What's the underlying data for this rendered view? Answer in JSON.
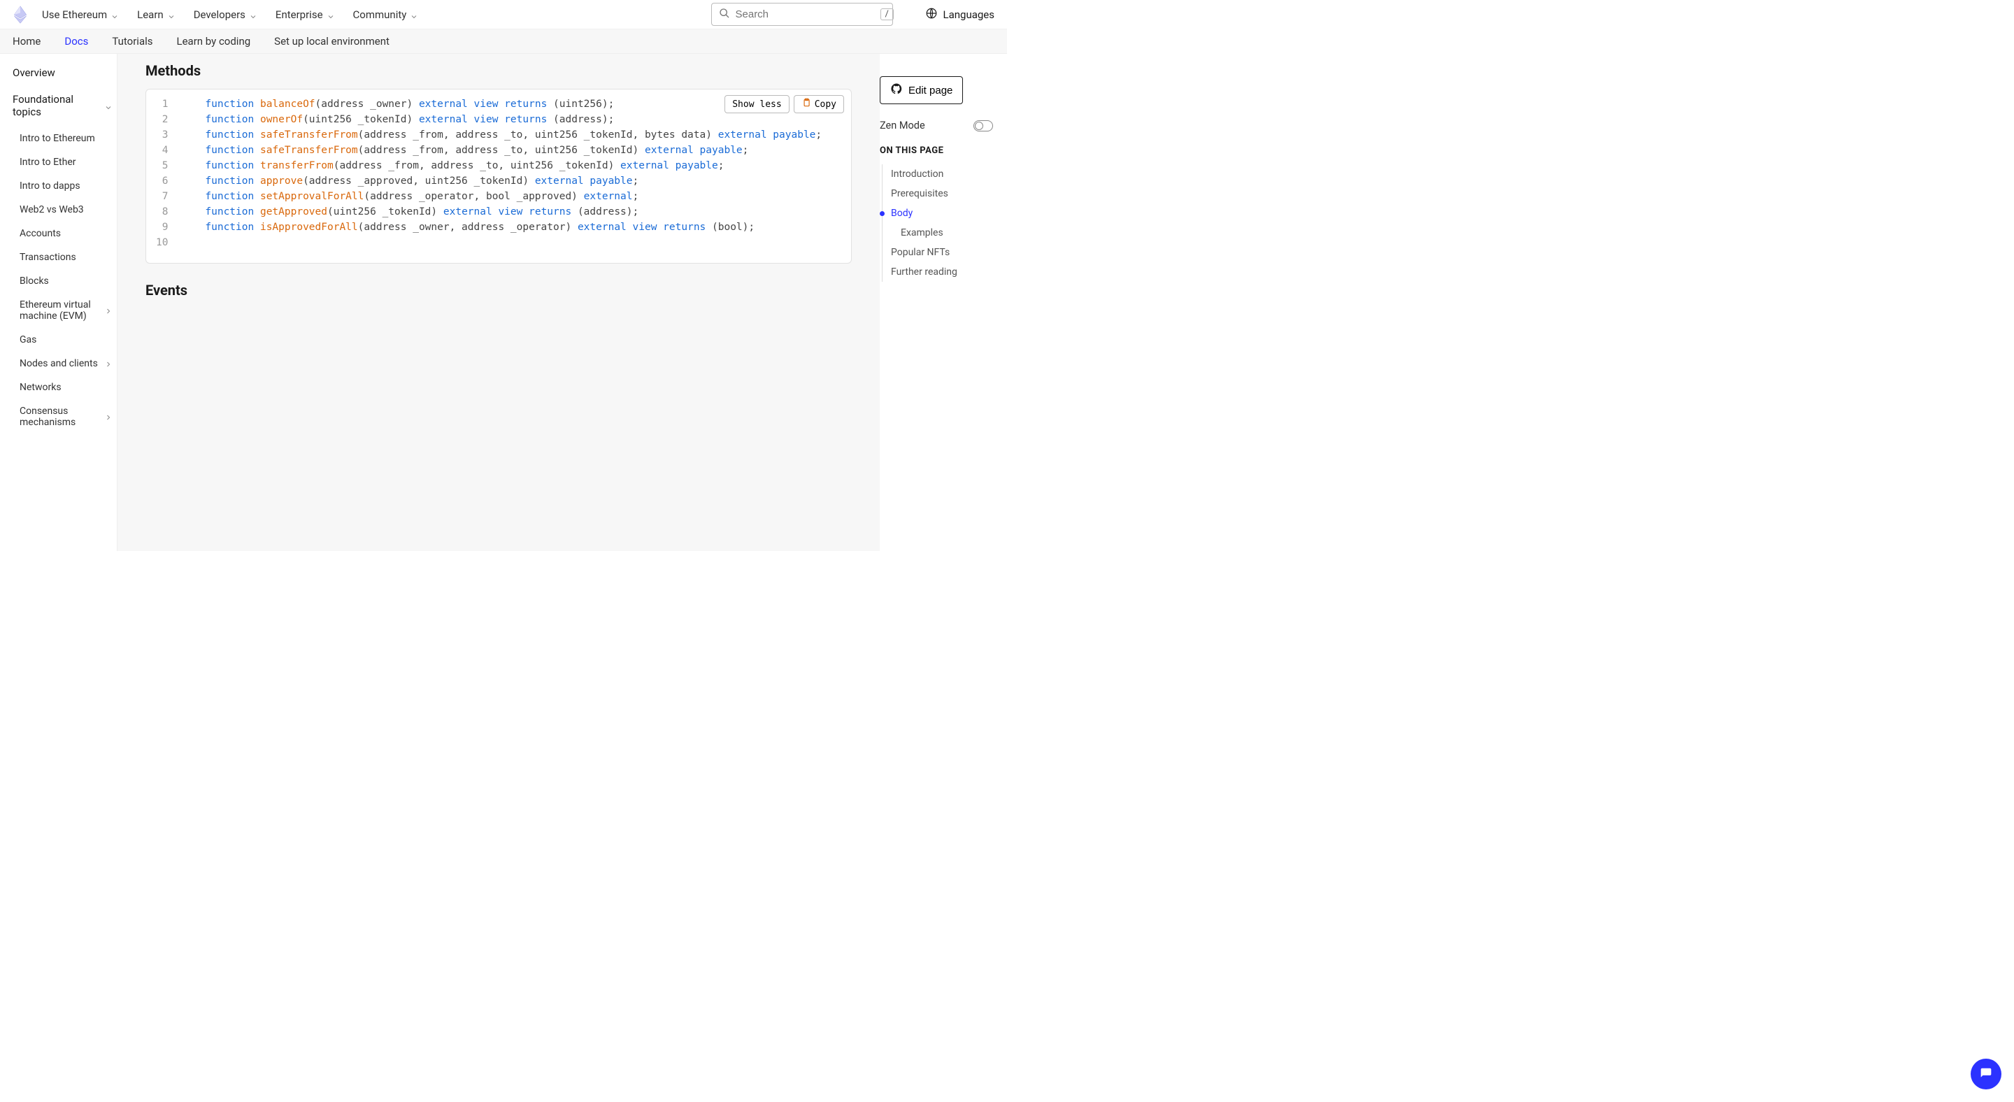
{
  "topnav": {
    "items": [
      "Use Ethereum",
      "Learn",
      "Developers",
      "Enterprise",
      "Community"
    ],
    "search_placeholder": "Search",
    "search_kbd": "/",
    "languages_label": "Languages"
  },
  "subnav": {
    "items": [
      "Home",
      "Docs",
      "Tutorials",
      "Learn by coding",
      "Set up local environment"
    ],
    "active_index": 1
  },
  "sidebar": {
    "overview": "Overview",
    "section": "Foundational topics",
    "items": [
      {
        "label": "Intro to Ethereum",
        "sub": false
      },
      {
        "label": "Intro to Ether",
        "sub": false
      },
      {
        "label": "Intro to dapps",
        "sub": false
      },
      {
        "label": "Web2 vs Web3",
        "sub": false
      },
      {
        "label": "Accounts",
        "sub": false
      },
      {
        "label": "Transactions",
        "sub": false
      },
      {
        "label": "Blocks",
        "sub": false
      },
      {
        "label": "Ethereum virtual machine (EVM)",
        "sub": true
      },
      {
        "label": "Gas",
        "sub": false
      },
      {
        "label": "Nodes and clients",
        "sub": true
      },
      {
        "label": "Networks",
        "sub": false
      },
      {
        "label": "Consensus mechanisms",
        "sub": true
      }
    ]
  },
  "main": {
    "heading_methods": "Methods",
    "heading_events": "Events",
    "show_less": "Show less",
    "copy": "Copy",
    "code_lines": [
      [
        {
          "t": "    ",
          "c": "tx"
        },
        {
          "t": "function",
          "c": "kw"
        },
        {
          "t": " ",
          "c": "tx"
        },
        {
          "t": "balanceOf",
          "c": "fn"
        },
        {
          "t": "(address _owner) ",
          "c": "tx"
        },
        {
          "t": "external",
          "c": "kw"
        },
        {
          "t": " ",
          "c": "tx"
        },
        {
          "t": "view",
          "c": "kw"
        },
        {
          "t": " ",
          "c": "tx"
        },
        {
          "t": "returns",
          "c": "kw"
        },
        {
          "t": " (uint256);",
          "c": "tx"
        }
      ],
      [
        {
          "t": "    ",
          "c": "tx"
        },
        {
          "t": "function",
          "c": "kw"
        },
        {
          "t": " ",
          "c": "tx"
        },
        {
          "t": "ownerOf",
          "c": "fn"
        },
        {
          "t": "(uint256 _tokenId) ",
          "c": "tx"
        },
        {
          "t": "external",
          "c": "kw"
        },
        {
          "t": " ",
          "c": "tx"
        },
        {
          "t": "view",
          "c": "kw"
        },
        {
          "t": " ",
          "c": "tx"
        },
        {
          "t": "returns",
          "c": "kw"
        },
        {
          "t": " (address);",
          "c": "tx"
        }
      ],
      [
        {
          "t": "    ",
          "c": "tx"
        },
        {
          "t": "function",
          "c": "kw"
        },
        {
          "t": " ",
          "c": "tx"
        },
        {
          "t": "safeTransferFrom",
          "c": "fn"
        },
        {
          "t": "(address _from, address _to, uint256 _tokenId, bytes data) ",
          "c": "tx"
        },
        {
          "t": "external",
          "c": "kw"
        },
        {
          "t": " ",
          "c": "tx"
        },
        {
          "t": "payable",
          "c": "kw"
        },
        {
          "t": ";",
          "c": "tx"
        }
      ],
      [
        {
          "t": "    ",
          "c": "tx"
        },
        {
          "t": "function",
          "c": "kw"
        },
        {
          "t": " ",
          "c": "tx"
        },
        {
          "t": "safeTransferFrom",
          "c": "fn"
        },
        {
          "t": "(address _from, address _to, uint256 _tokenId) ",
          "c": "tx"
        },
        {
          "t": "external",
          "c": "kw"
        },
        {
          "t": " ",
          "c": "tx"
        },
        {
          "t": "payable",
          "c": "kw"
        },
        {
          "t": ";",
          "c": "tx"
        }
      ],
      [
        {
          "t": "    ",
          "c": "tx"
        },
        {
          "t": "function",
          "c": "kw"
        },
        {
          "t": " ",
          "c": "tx"
        },
        {
          "t": "transferFrom",
          "c": "fn"
        },
        {
          "t": "(address _from, address _to, uint256 _tokenId) ",
          "c": "tx"
        },
        {
          "t": "external",
          "c": "kw"
        },
        {
          "t": " ",
          "c": "tx"
        },
        {
          "t": "payable",
          "c": "kw"
        },
        {
          "t": ";",
          "c": "tx"
        }
      ],
      [
        {
          "t": "    ",
          "c": "tx"
        },
        {
          "t": "function",
          "c": "kw"
        },
        {
          "t": " ",
          "c": "tx"
        },
        {
          "t": "approve",
          "c": "fn"
        },
        {
          "t": "(address _approved, uint256 _tokenId) ",
          "c": "tx"
        },
        {
          "t": "external",
          "c": "kw"
        },
        {
          "t": " ",
          "c": "tx"
        },
        {
          "t": "payable",
          "c": "kw"
        },
        {
          "t": ";",
          "c": "tx"
        }
      ],
      [
        {
          "t": "    ",
          "c": "tx"
        },
        {
          "t": "function",
          "c": "kw"
        },
        {
          "t": " ",
          "c": "tx"
        },
        {
          "t": "setApprovalForAll",
          "c": "fn"
        },
        {
          "t": "(address _operator, bool _approved) ",
          "c": "tx"
        },
        {
          "t": "external",
          "c": "kw"
        },
        {
          "t": ";",
          "c": "tx"
        }
      ],
      [
        {
          "t": "    ",
          "c": "tx"
        },
        {
          "t": "function",
          "c": "kw"
        },
        {
          "t": " ",
          "c": "tx"
        },
        {
          "t": "getApproved",
          "c": "fn"
        },
        {
          "t": "(uint256 _tokenId) ",
          "c": "tx"
        },
        {
          "t": "external",
          "c": "kw"
        },
        {
          "t": " ",
          "c": "tx"
        },
        {
          "t": "view",
          "c": "kw"
        },
        {
          "t": " ",
          "c": "tx"
        },
        {
          "t": "returns",
          "c": "kw"
        },
        {
          "t": " (address);",
          "c": "tx"
        }
      ],
      [
        {
          "t": "    ",
          "c": "tx"
        },
        {
          "t": "function",
          "c": "kw"
        },
        {
          "t": " ",
          "c": "tx"
        },
        {
          "t": "isApprovedForAll",
          "c": "fn"
        },
        {
          "t": "(address _owner, address _operator) ",
          "c": "tx"
        },
        {
          "t": "external",
          "c": "kw"
        },
        {
          "t": " ",
          "c": "tx"
        },
        {
          "t": "view",
          "c": "kw"
        },
        {
          "t": " ",
          "c": "tx"
        },
        {
          "t": "returns",
          "c": "kw"
        },
        {
          "t": " (bool);",
          "c": "tx"
        }
      ],
      []
    ]
  },
  "rightcol": {
    "edit_page": "Edit page",
    "zen_mode": "Zen Mode",
    "toc_heading": "ON THIS PAGE",
    "toc": [
      {
        "label": "Introduction",
        "sub": false,
        "active": false
      },
      {
        "label": "Prerequisites",
        "sub": false,
        "active": false
      },
      {
        "label": "Body",
        "sub": false,
        "active": true
      },
      {
        "label": "Examples",
        "sub": true,
        "active": false
      },
      {
        "label": "Popular NFTs",
        "sub": false,
        "active": false
      },
      {
        "label": "Further reading",
        "sub": false,
        "active": false
      }
    ]
  }
}
